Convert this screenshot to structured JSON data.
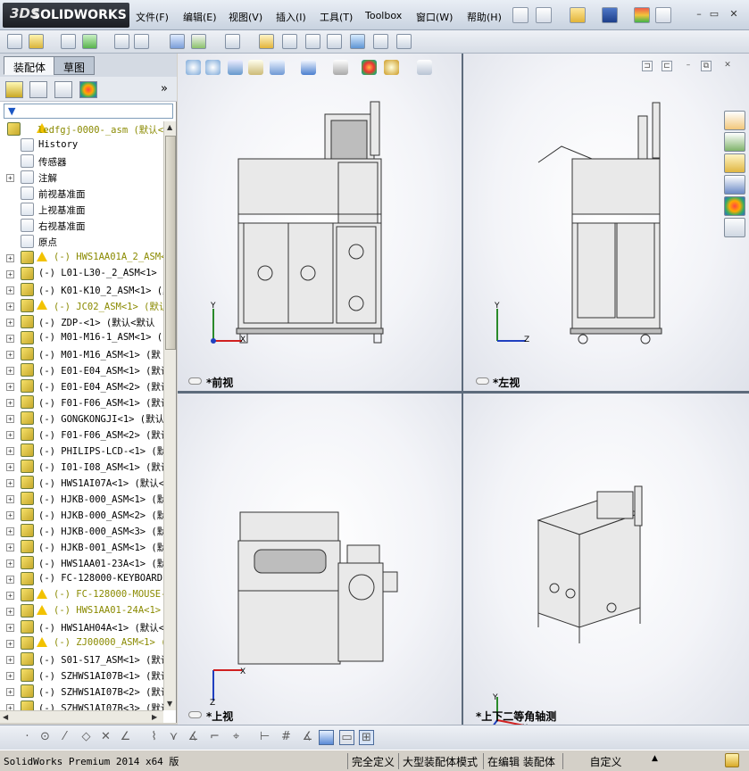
{
  "app": {
    "brand": "SOLIDWORKS",
    "brand_prefix": "3DS"
  },
  "menu": [
    "文件(F)",
    "编辑(E)",
    "视图(V)",
    "插入(I)",
    "工具(T)",
    "Toolbox",
    "窗口(W)",
    "帮助(H)"
  ],
  "panel_tabs": [
    "装配体",
    "草图"
  ],
  "panel_expand": "»",
  "tree": [
    {
      "label": "ledfgj-0000-_asm  (默认<",
      "expand": "",
      "warn": true,
      "olive": true,
      "kind": "root"
    },
    {
      "label": "History",
      "expand": "",
      "warn": false,
      "olive": false,
      "kind": "sub"
    },
    {
      "label": "传感器",
      "expand": "",
      "warn": false,
      "olive": false,
      "kind": "sub"
    },
    {
      "label": "注解",
      "expand": "+",
      "warn": false,
      "olive": false,
      "kind": "sub"
    },
    {
      "label": "前视基准面",
      "expand": "",
      "warn": false,
      "olive": false,
      "kind": "sub"
    },
    {
      "label": "上视基准面",
      "expand": "",
      "warn": false,
      "olive": false,
      "kind": "sub"
    },
    {
      "label": "右视基准面",
      "expand": "",
      "warn": false,
      "olive": false,
      "kind": "sub"
    },
    {
      "label": "原点",
      "expand": "",
      "warn": false,
      "olive": false,
      "kind": "sub"
    },
    {
      "label": "(-) HWS1AA01A_2_ASM<",
      "expand": "+",
      "warn": true,
      "olive": true,
      "kind": "item"
    },
    {
      "label": "(-) L01-L30-_2_ASM<1> (",
      "expand": "+",
      "warn": false,
      "olive": false,
      "kind": "item"
    },
    {
      "label": "(-) K01-K10_2_ASM<1> (默",
      "expand": "+",
      "warn": false,
      "olive": false,
      "kind": "item"
    },
    {
      "label": "(-) JC02_ASM<1> (默认",
      "expand": "+",
      "warn": true,
      "olive": true,
      "kind": "item"
    },
    {
      "label": "(-) ZDP-<1> (默认<默认",
      "expand": "+",
      "warn": false,
      "olive": false,
      "kind": "item"
    },
    {
      "label": "(-) M01-M16-1_ASM<1> (",
      "expand": "+",
      "warn": false,
      "olive": false,
      "kind": "item"
    },
    {
      "label": "(-) M01-M16_ASM<1> (默",
      "expand": "+",
      "warn": false,
      "olive": false,
      "kind": "item"
    },
    {
      "label": "(-) E01-E04_ASM<1> (默认",
      "expand": "+",
      "warn": false,
      "olive": false,
      "kind": "item"
    },
    {
      "label": "(-) E01-E04_ASM<2> (默认",
      "expand": "+",
      "warn": false,
      "olive": false,
      "kind": "item"
    },
    {
      "label": "(-) F01-F06_ASM<1> (默认",
      "expand": "+",
      "warn": false,
      "olive": false,
      "kind": "item"
    },
    {
      "label": "(-) GONGKONGJI<1> (默认",
      "expand": "+",
      "warn": false,
      "olive": false,
      "kind": "item"
    },
    {
      "label": "(-) F01-F06_ASM<2> (默认",
      "expand": "+",
      "warn": false,
      "olive": false,
      "kind": "item"
    },
    {
      "label": "(-) PHILIPS-LCD-<1> (默",
      "expand": "+",
      "warn": false,
      "olive": false,
      "kind": "item"
    },
    {
      "label": "(-) I01-I08_ASM<1> (默认",
      "expand": "+",
      "warn": false,
      "olive": false,
      "kind": "item"
    },
    {
      "label": "(-) HWS1AI07A<1> (默认<",
      "expand": "+",
      "warn": false,
      "olive": false,
      "kind": "item"
    },
    {
      "label": "(-) HJKB-000_ASM<1> (默",
      "expand": "+",
      "warn": false,
      "olive": false,
      "kind": "item"
    },
    {
      "label": "(-) HJKB-000_ASM<2> (默",
      "expand": "+",
      "warn": false,
      "olive": false,
      "kind": "item"
    },
    {
      "label": "(-) HJKB-000_ASM<3> (默",
      "expand": "+",
      "warn": false,
      "olive": false,
      "kind": "item"
    },
    {
      "label": "(-) HJKB-001_ASM<1> (默",
      "expand": "+",
      "warn": false,
      "olive": false,
      "kind": "item"
    },
    {
      "label": "(-) HWS1AA01-23A<1> (默",
      "expand": "+",
      "warn": false,
      "olive": false,
      "kind": "item"
    },
    {
      "label": "(-) FC-128000-KEYBOARD-",
      "expand": "+",
      "warn": false,
      "olive": false,
      "kind": "item"
    },
    {
      "label": "(-) FC-128000-MOUSE-",
      "expand": "+",
      "warn": true,
      "olive": true,
      "kind": "item"
    },
    {
      "label": "(-) HWS1AA01-24A<1>",
      "expand": "+",
      "warn": true,
      "olive": true,
      "kind": "item"
    },
    {
      "label": "(-) HWS1AH04A<1> (默认<",
      "expand": "+",
      "warn": false,
      "olive": false,
      "kind": "item"
    },
    {
      "label": "(-) ZJ00000_ASM<1> (",
      "expand": "+",
      "warn": true,
      "olive": true,
      "kind": "item"
    },
    {
      "label": "(-) S01-S17_ASM<1> (默认",
      "expand": "+",
      "warn": false,
      "olive": false,
      "kind": "item"
    },
    {
      "label": "(-) SZHWS1AI07B<1> (默认",
      "expand": "+",
      "warn": false,
      "olive": false,
      "kind": "item"
    },
    {
      "label": "(-) SZHWS1AI07B<2> (默认",
      "expand": "+",
      "warn": false,
      "olive": false,
      "kind": "item"
    },
    {
      "label": "(-) SZHWS1AI07B<3> (默认",
      "expand": "+",
      "warn": false,
      "olive": false,
      "kind": "item"
    }
  ],
  "views": {
    "front": "*前视",
    "left": "*左视",
    "top": "*上视",
    "iso": "*上下二等角轴测"
  },
  "axes": {
    "x": "X",
    "y": "Y",
    "z": "Z"
  },
  "status": {
    "product": "SolidWorks Premium 2014 x64 版",
    "constraint": "完全定义",
    "mode": "大型装配体模式",
    "editing": "在编辑 装配体",
    "custom": "自定义",
    "caret": "▲"
  },
  "colors": {
    "accent": "#1a56c4",
    "warning": "#f2c200",
    "olive_text": "#8a8a00"
  }
}
